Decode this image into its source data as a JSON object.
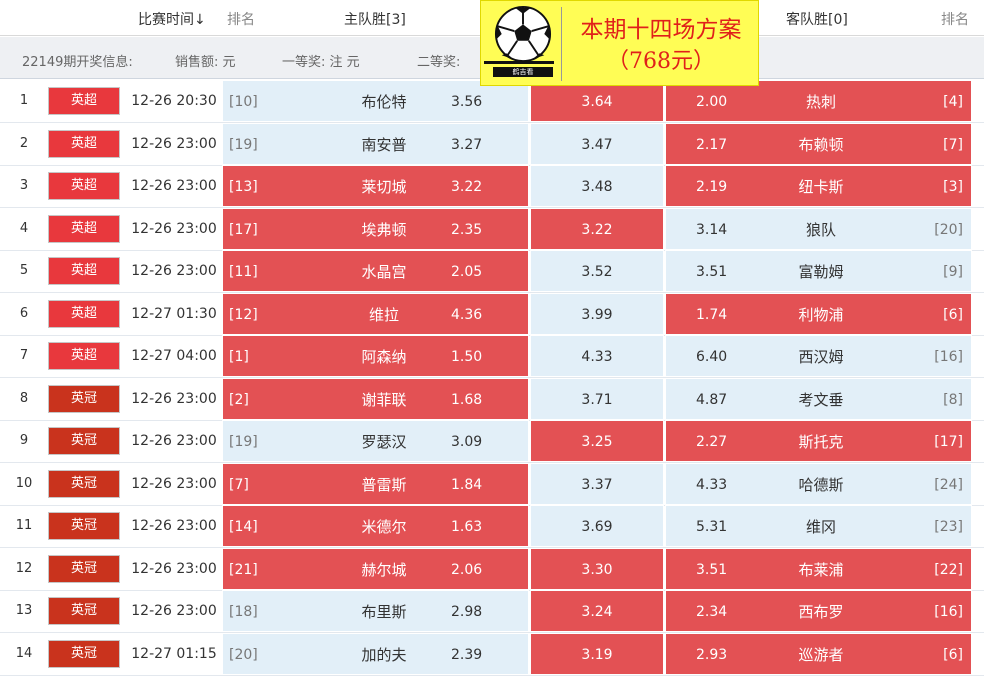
{
  "header": {
    "time_col": "比赛时间↓",
    "rank_col": "排名",
    "home_col": "主队胜[3]",
    "away_col": "客队胜[0]",
    "rank_col_right": "排名"
  },
  "info": {
    "issue": "22149期开奖信息:",
    "sales": "销售额:   元",
    "first": "一等奖:   注   元",
    "second": "二等奖:"
  },
  "banner": {
    "title": "本期十四场方案",
    "price": "（768元）",
    "brand": "鹤吉看",
    "icon": "soccer-ball-icon"
  },
  "colors": {
    "highlight": "#e35154",
    "normal": "#e2eff8",
    "league_epl": "#e8383d",
    "league_championship": "#c9331d"
  },
  "rows": [
    {
      "num": "1",
      "league": "英超",
      "time": "12-26 20:30",
      "home_rank": "[10]",
      "home": "布伦特",
      "home_odd": "3.56",
      "draw": "3.64",
      "away_odd": "2.00",
      "away": "热刺",
      "away_rank": "[4]",
      "home_hl": false,
      "draw_hl": true,
      "away_hl": true
    },
    {
      "num": "2",
      "league": "英超",
      "time": "12-26 23:00",
      "home_rank": "[19]",
      "home": "南安普",
      "home_odd": "3.27",
      "draw": "3.47",
      "away_odd": "2.17",
      "away": "布赖顿",
      "away_rank": "[7]",
      "home_hl": false,
      "draw_hl": false,
      "away_hl": true
    },
    {
      "num": "3",
      "league": "英超",
      "time": "12-26 23:00",
      "home_rank": "[13]",
      "home": "莱切城",
      "home_odd": "3.22",
      "draw": "3.48",
      "away_odd": "2.19",
      "away": "纽卡斯",
      "away_rank": "[3]",
      "home_hl": true,
      "draw_hl": false,
      "away_hl": true
    },
    {
      "num": "4",
      "league": "英超",
      "time": "12-26 23:00",
      "home_rank": "[17]",
      "home": "埃弗顿",
      "home_odd": "2.35",
      "draw": "3.22",
      "away_odd": "3.14",
      "away": "狼队",
      "away_rank": "[20]",
      "home_hl": true,
      "draw_hl": true,
      "away_hl": false
    },
    {
      "num": "5",
      "league": "英超",
      "time": "12-26 23:00",
      "home_rank": "[11]",
      "home": "水晶宫",
      "home_odd": "2.05",
      "draw": "3.52",
      "away_odd": "3.51",
      "away": "富勒姆",
      "away_rank": "[9]",
      "home_hl": true,
      "draw_hl": false,
      "away_hl": false
    },
    {
      "num": "6",
      "league": "英超",
      "time": "12-27 01:30",
      "home_rank": "[12]",
      "home": "维拉",
      "home_odd": "4.36",
      "draw": "3.99",
      "away_odd": "1.74",
      "away": "利物浦",
      "away_rank": "[6]",
      "home_hl": true,
      "draw_hl": false,
      "away_hl": true
    },
    {
      "num": "7",
      "league": "英超",
      "time": "12-27 04:00",
      "home_rank": "[1]",
      "home": "阿森纳",
      "home_odd": "1.50",
      "draw": "4.33",
      "away_odd": "6.40",
      "away": "西汉姆",
      "away_rank": "[16]",
      "home_hl": true,
      "draw_hl": false,
      "away_hl": false
    },
    {
      "num": "8",
      "league": "英冠",
      "time": "12-26 23:00",
      "home_rank": "[2]",
      "home": "谢菲联",
      "home_odd": "1.68",
      "draw": "3.71",
      "away_odd": "4.87",
      "away": "考文垂",
      "away_rank": "[8]",
      "home_hl": true,
      "draw_hl": false,
      "away_hl": false
    },
    {
      "num": "9",
      "league": "英冠",
      "time": "12-26 23:00",
      "home_rank": "[19]",
      "home": "罗瑟汉",
      "home_odd": "3.09",
      "draw": "3.25",
      "away_odd": "2.27",
      "away": "斯托克",
      "away_rank": "[17]",
      "home_hl": false,
      "draw_hl": true,
      "away_hl": true
    },
    {
      "num": "10",
      "league": "英冠",
      "time": "12-26 23:00",
      "home_rank": "[7]",
      "home": "普雷斯",
      "home_odd": "1.84",
      "draw": "3.37",
      "away_odd": "4.33",
      "away": "哈德斯",
      "away_rank": "[24]",
      "home_hl": true,
      "draw_hl": false,
      "away_hl": false
    },
    {
      "num": "11",
      "league": "英冠",
      "time": "12-26 23:00",
      "home_rank": "[14]",
      "home": "米德尔",
      "home_odd": "1.63",
      "draw": "3.69",
      "away_odd": "5.31",
      "away": "维冈",
      "away_rank": "[23]",
      "home_hl": true,
      "draw_hl": false,
      "away_hl": false
    },
    {
      "num": "12",
      "league": "英冠",
      "time": "12-26 23:00",
      "home_rank": "[21]",
      "home": "赫尔城",
      "home_odd": "2.06",
      "draw": "3.30",
      "away_odd": "3.51",
      "away": "布莱浦",
      "away_rank": "[22]",
      "home_hl": true,
      "draw_hl": true,
      "away_hl": true
    },
    {
      "num": "13",
      "league": "英冠",
      "time": "12-26 23:00",
      "home_rank": "[18]",
      "home": "布里斯",
      "home_odd": "2.98",
      "draw": "3.24",
      "away_odd": "2.34",
      "away": "西布罗",
      "away_rank": "[16]",
      "home_hl": false,
      "draw_hl": true,
      "away_hl": true
    },
    {
      "num": "14",
      "league": "英冠",
      "time": "12-27 01:15",
      "home_rank": "[20]",
      "home": "加的夫",
      "home_odd": "2.39",
      "draw": "3.19",
      "away_odd": "2.93",
      "away": "巡游者",
      "away_rank": "[6]",
      "home_hl": false,
      "draw_hl": true,
      "away_hl": true
    }
  ]
}
